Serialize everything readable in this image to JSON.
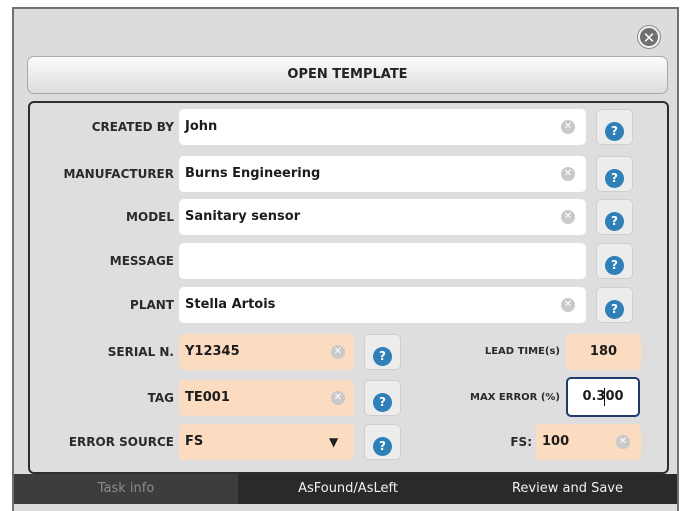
{
  "header": {
    "close_icon": "close-icon",
    "open_template_label": "OPEN TEMPLATE"
  },
  "form": {
    "created_by": {
      "label": "CREATED BY",
      "value": "John"
    },
    "manufacturer": {
      "label": "MANUFACTURER",
      "value": "Burns Engineering"
    },
    "model": {
      "label": "MODEL",
      "value": "Sanitary sensor"
    },
    "message": {
      "label": "MESSAGE",
      "value": ""
    },
    "plant": {
      "label": "PLANT",
      "value": "Stella Artois"
    },
    "serial": {
      "label": "SERIAL N.",
      "value": "Y12345"
    },
    "tag": {
      "label": "TAG",
      "value": "TE001"
    },
    "error_source": {
      "label": "ERROR SOURCE",
      "value": "FS"
    },
    "lead_time": {
      "label": "LEAD TIME(s)",
      "value": "180"
    },
    "max_error": {
      "label": "MAX ERROR (%)",
      "value": "0.300"
    },
    "fs": {
      "label": "FS:",
      "value": "100"
    }
  },
  "help_icon": "help-icon",
  "clear_icon": "clear-icon",
  "tabs": [
    {
      "label": "Task info",
      "active": true
    },
    {
      "label": "AsFound/AsLeft",
      "active": false
    },
    {
      "label": "Review and Save",
      "active": false
    }
  ],
  "colors": {
    "accent_help": "#2f7fb8",
    "field_peach": "#fbdcc0",
    "tab_bar": "#2a2a2a"
  }
}
